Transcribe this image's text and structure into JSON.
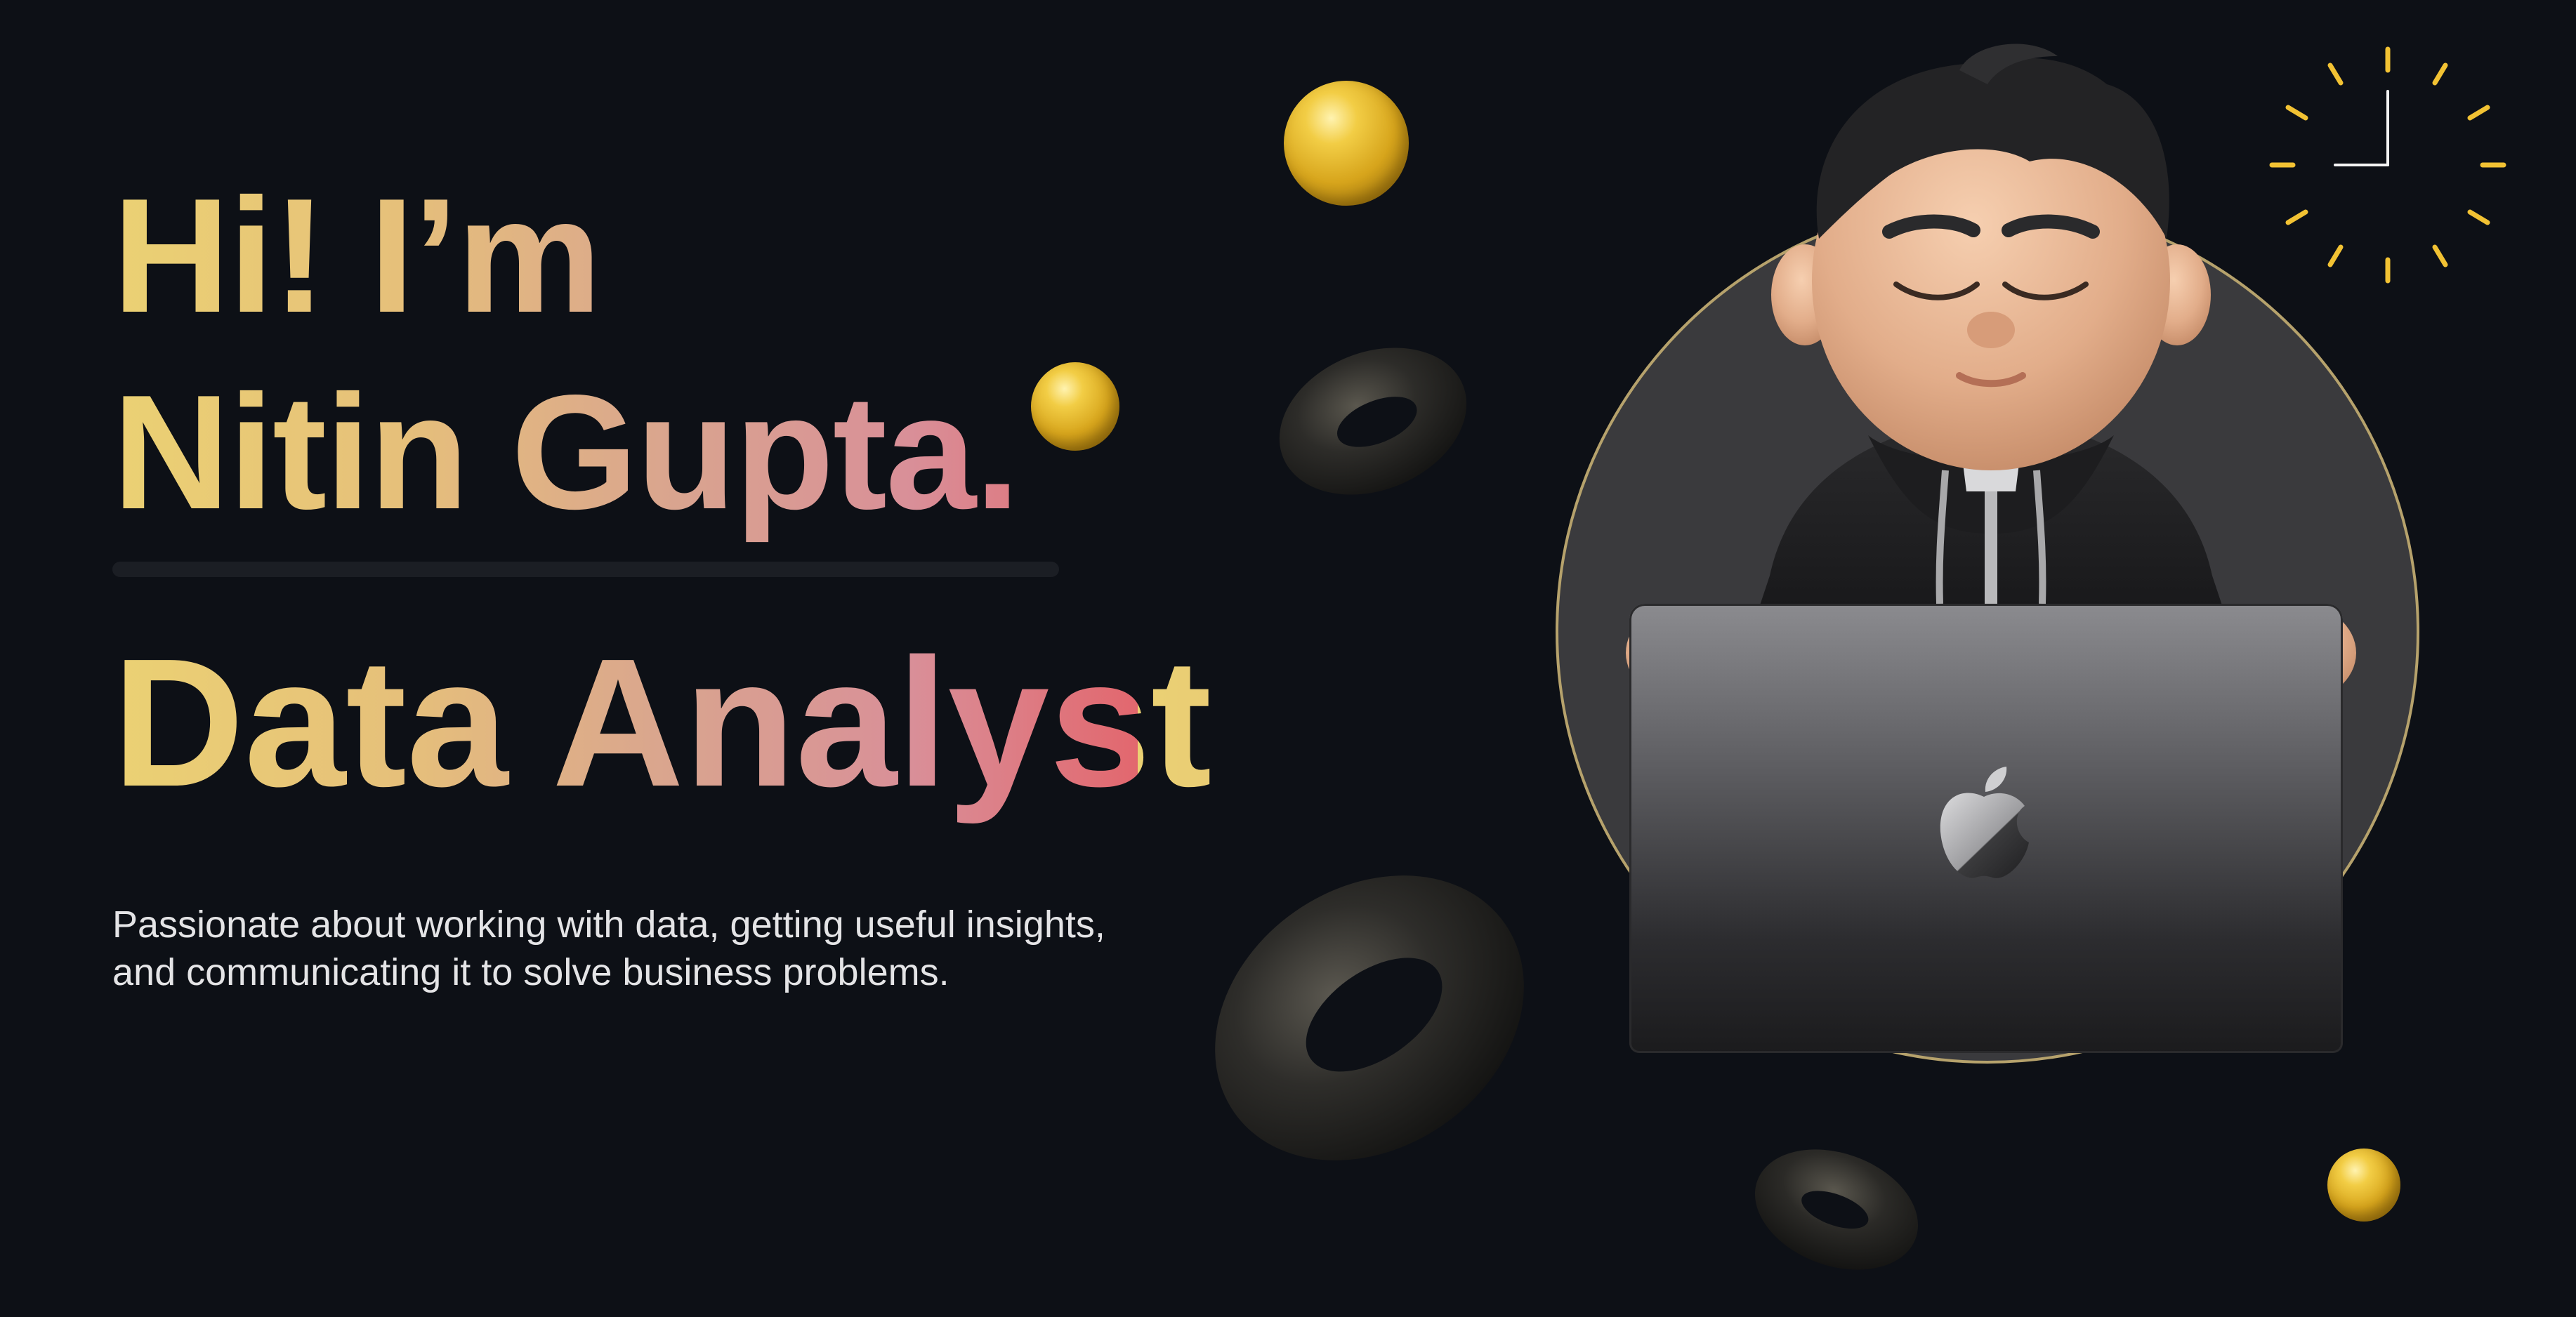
{
  "hero": {
    "greeting": "Hi! I’m",
    "name": "Nitin Gupta.",
    "role": "Data Analyst",
    "tagline_line1": "Passionate about working with data, getting useful insights,",
    "tagline_line2": "and communicating it to solve business problems."
  },
  "illustration": {
    "avatar_icon": "memoji-avatar-icon",
    "laptop_icon": "laptop-icon",
    "logo_icon": "apple-logo-icon",
    "clock_icon": "clock-icon",
    "decor": [
      "gold-sphere-icon",
      "dark-torus-icon"
    ]
  },
  "colors": {
    "background": "#0d1016",
    "gradient_start": "#ebd173",
    "gradient_mid": "#d9a48f",
    "gradient_end": "#e2676e",
    "gold": "#f2cd45",
    "backdrop": "#3a3a3d",
    "backdrop_ring": "#b6a26c",
    "tagline_text": "#e4e4e6"
  }
}
